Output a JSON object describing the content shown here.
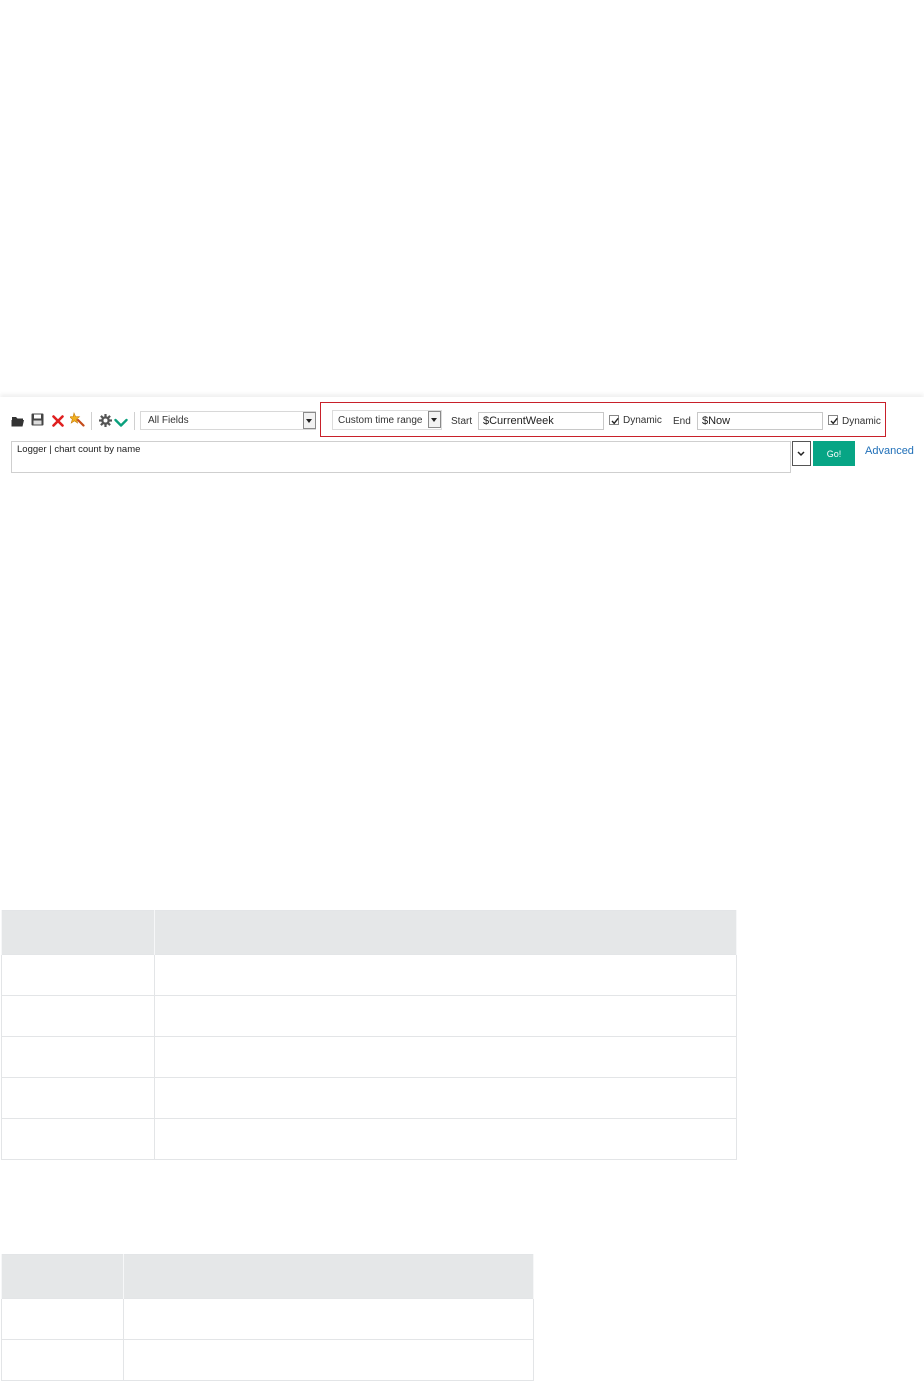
{
  "toolbar": {
    "icons": [
      "folder-open-icon",
      "save-icon",
      "delete-icon",
      "clear-icon",
      "settings-icon",
      "chevron-down-icon"
    ],
    "field_select": "All Fields",
    "time_range": "Custom time range",
    "start_label": "Start",
    "start_value": "$CurrentWeek",
    "start_dynamic_label": "Dynamic",
    "start_dynamic_checked": true,
    "end_label": "End",
    "end_value": "$Now",
    "end_dynamic_label": "Dynamic",
    "end_dynamic_checked": true,
    "highlight_color": "#c8202a"
  },
  "query": {
    "value": "Logger | chart count by name",
    "go_label": "Go!",
    "advanced_label": "Advanced",
    "go_color": "#07a585"
  },
  "tables": [
    {
      "header": [
        "",
        ""
      ],
      "rows": [
        [
          "",
          ""
        ],
        [
          "",
          ""
        ],
        [
          "",
          ""
        ],
        [
          "",
          ""
        ],
        [
          "",
          ""
        ]
      ]
    },
    {
      "header": [
        "",
        ""
      ],
      "rows": [
        [
          "",
          ""
        ],
        [
          "",
          ""
        ]
      ]
    }
  ]
}
